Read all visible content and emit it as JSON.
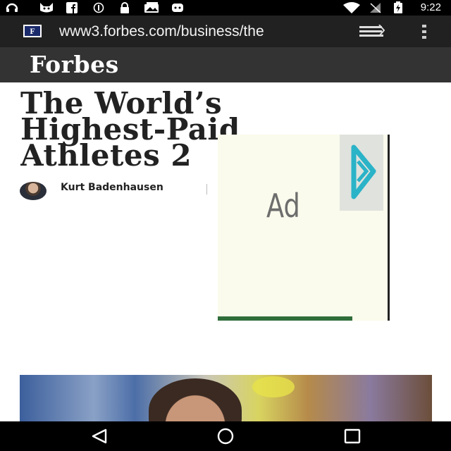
{
  "status_bar": {
    "time": "9:22",
    "icons": [
      "headset-icon",
      "cat-icon",
      "facebook-icon",
      "stop-icon",
      "lock-icon",
      "photo-icon",
      "android-icon",
      "wifi-icon",
      "signal-icon",
      "battery-icon"
    ]
  },
  "browser": {
    "favicon_letter": "F",
    "url": "www3.forbes.com/business/the"
  },
  "header": {
    "logo": "Forbes"
  },
  "article": {
    "title": "The World’s Highest-Paid Athletes 2",
    "author": "Kurt Badenhausen"
  },
  "ad": {
    "label": "Ad"
  },
  "colors": {
    "header_bg": "#333333",
    "url_bar_bg": "#212121",
    "ad_bg": "#fafbec",
    "ad_choices": "#2bb3c8"
  }
}
